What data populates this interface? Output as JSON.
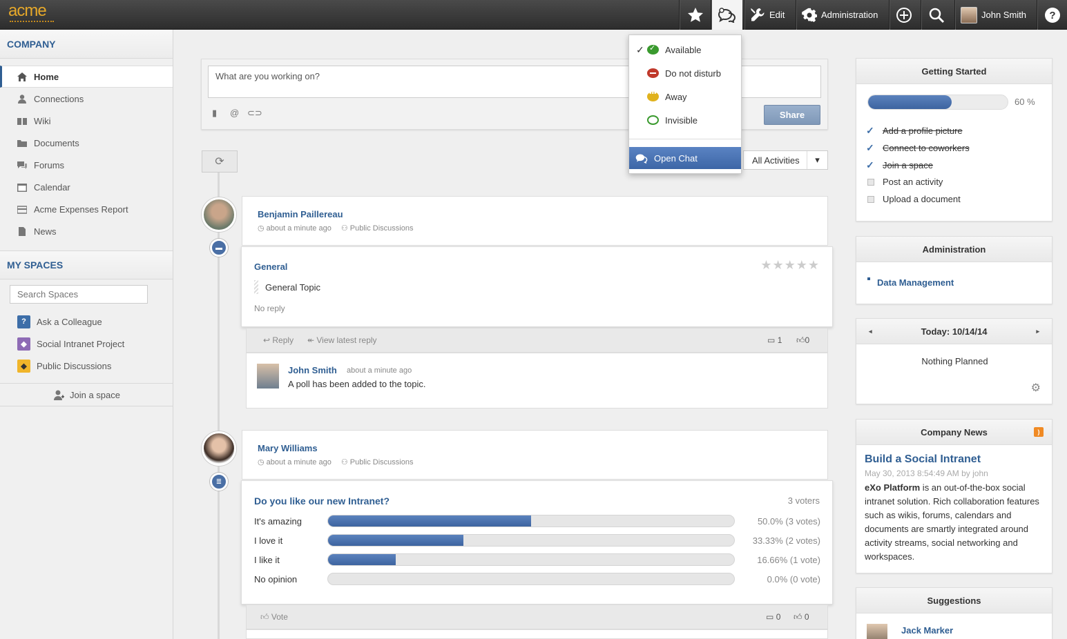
{
  "brand": {
    "logo": "acme",
    "accent": "#e6a82a",
    "link_color": "#2f5e92"
  },
  "topbar": {
    "favorites_icon": "star-icon",
    "chat_icon": "chat-bubbles-icon",
    "edit_label": "Edit",
    "admin_label": "Administration",
    "user_name": "John Smith"
  },
  "sidebar": {
    "company_title": "COMPANY",
    "nav": [
      {
        "label": "Home",
        "icon": "home-icon"
      },
      {
        "label": "Connections",
        "icon": "person-icon"
      },
      {
        "label": "Wiki",
        "icon": "book-icon"
      },
      {
        "label": "Documents",
        "icon": "folder-icon"
      },
      {
        "label": "Forums",
        "icon": "forum-icon"
      },
      {
        "label": "Calendar",
        "icon": "calendar-icon"
      },
      {
        "label": "Acme Expenses Report",
        "icon": "card-icon"
      },
      {
        "label": "News",
        "icon": "document-icon"
      }
    ],
    "spaces_title": "MY SPACES",
    "search_placeholder": "Search Spaces",
    "spaces": [
      {
        "label": "Ask a Colleague",
        "color": "#3d6ea8",
        "glyph": "?"
      },
      {
        "label": "Social Intranet Project",
        "color": "#8e6bb5",
        "glyph": "◆"
      },
      {
        "label": "Public Discussions",
        "color": "#f0b52a",
        "glyph": "◆"
      }
    ],
    "join_label": "Join a space"
  },
  "composer": {
    "placeholder": "What are you working on?",
    "share_label": "Share"
  },
  "filter": {
    "selected": "All Activities"
  },
  "status_menu": {
    "items": [
      {
        "label": "Available",
        "color": "#3a9a2e",
        "checked": "✓"
      },
      {
        "label": "Do not disturb",
        "color": "#c0392b",
        "checked": ""
      },
      {
        "label": "Away",
        "color": "#e0b21d",
        "checked": ""
      },
      {
        "label": "Invisible",
        "color": "#3a9a2e",
        "checked": ""
      }
    ],
    "open_chat": "Open Chat"
  },
  "activities": [
    {
      "author": "Benjamin Paillereau",
      "time": "about a minute ago",
      "space": "Public Discussions",
      "forum": "General",
      "topic": "General Topic",
      "status": "No reply",
      "reply_label": "Reply",
      "view_reply_label": "View latest reply",
      "comment_count": "1",
      "like_count": "0",
      "comment": {
        "author": "John Smith",
        "time": "about a minute ago",
        "text": "A poll has been added to the topic."
      }
    },
    {
      "author": "Mary Williams",
      "time": "about a minute ago",
      "space": "Public Discussions",
      "question": "Do you like our new Intranet?",
      "voters": "3 voters",
      "options": [
        {
          "label": "It's amazing",
          "share": 0.5,
          "result": "50.0% (3 votes)"
        },
        {
          "label": "I love it",
          "share": 0.3333,
          "result": "33.33% (2 votes)"
        },
        {
          "label": "I like it",
          "share": 0.1666,
          "result": "16.66% (1 vote)"
        },
        {
          "label": "No opinion",
          "share": 0.0,
          "result": "0.0% (0 vote)"
        }
      ],
      "vote_label": "Vote",
      "comment_count": "0",
      "like_count": "0"
    }
  ],
  "getting_started": {
    "title": "Getting Started",
    "progress": 0.6,
    "progress_label": "60 %",
    "items": [
      {
        "label": "Add a profile picture",
        "done": true
      },
      {
        "label": "Connect to coworkers",
        "done": true
      },
      {
        "label": "Join a space",
        "done": true
      },
      {
        "label": "Post an activity",
        "done": false
      },
      {
        "label": "Upload a document",
        "done": false
      }
    ]
  },
  "administration": {
    "title": "Administration",
    "link": "Data Management"
  },
  "calendar": {
    "title": "Today: 10/14/14",
    "empty": "Nothing Planned"
  },
  "news": {
    "title": "Company News",
    "headline": "Build a Social Intranet",
    "date": "May 30, 2013 8:54:49 AM by john",
    "lead": "eXo Platform",
    "body": " is an out-of-the-box social intranet solution. Rich collaboration features such as wikis, forums, calendars and documents are smartly integrated around activity streams, social networking and workspaces."
  },
  "suggestions": {
    "title": "Suggestions",
    "first": "Jack Marker"
  }
}
